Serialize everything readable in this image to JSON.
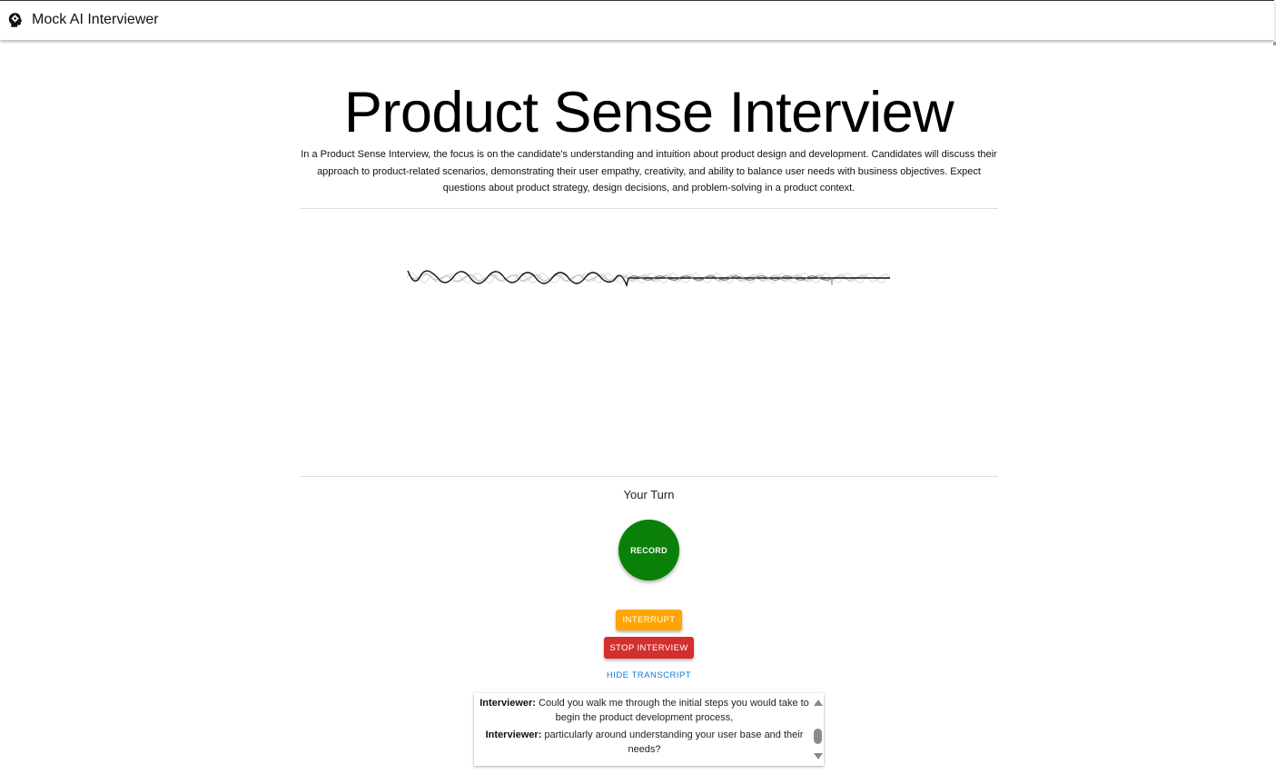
{
  "header": {
    "app_title": "Mock AI Interviewer",
    "logo_icon": "brain-head-icon"
  },
  "interview": {
    "title": "Product Sense Interview",
    "description": "In a Product Sense Interview, the focus is on the candidate's understanding and intuition about product design and development. Candidates will discuss their approach to product-related scenarios, demonstrating their user empathy, creativity, and ability to balance user needs with business objectives. Expect questions about product strategy, design decisions, and problem-solving in a product context."
  },
  "status": {
    "turn_label": "Your Turn"
  },
  "controls": {
    "record_label": "RECORD",
    "interrupt_label": "INTERRUPT",
    "stop_label": "STOP INTERVIEW",
    "transcript_toggle_label": "HIDE TRANSCRIPT"
  },
  "transcript": {
    "entries": [
      {
        "speaker": "Interviewer:",
        "text": "Could you walk me through the initial steps you would take to begin the product development process,"
      },
      {
        "speaker": "Interviewer:",
        "text": "particularly around understanding your user base and their needs?"
      }
    ]
  },
  "colors": {
    "record": "#0a8008",
    "interrupt": "#fea503",
    "stop": "#d32f2f",
    "link": "#1976d2"
  }
}
